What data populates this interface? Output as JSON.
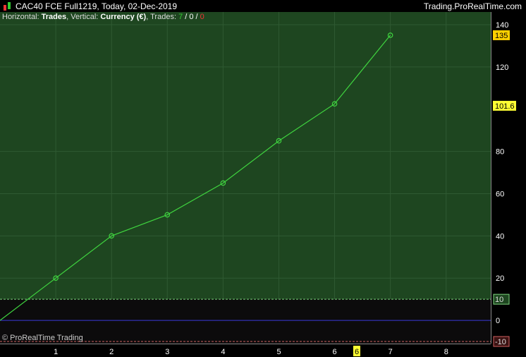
{
  "header": {
    "title": "CAC40 FCE Full1219, Today, 02-Dec-2019",
    "brand": "Trading.ProRealTime.com"
  },
  "info": {
    "h_label": "Horizontal: ",
    "h_value": "Trades",
    "v_label": ", Vertical: ",
    "v_value": "Currency (€)",
    "t_label": ", Trades: ",
    "t_win": "7",
    "sep1": " / ",
    "t_neutral": "0",
    "sep2": " / ",
    "t_loss": "0"
  },
  "copyright": "© ProRealTime Trading",
  "colors": {
    "profit_bg": "#1e4620",
    "neutral_bg": "#0c0b0c",
    "line": "#3fd43f",
    "grid": "#2f5a32",
    "zero_line": "#3a3ad8",
    "upper_band": "#7ed37e",
    "lower_band": "#d06060",
    "marker_fill": "#ffd000",
    "upper_tag_bg": "#1e4620",
    "lower_tag_bg": "#3a1212"
  },
  "chart_data": {
    "type": "line",
    "title": "",
    "xlabel": "Trades",
    "ylabel": "Currency (€)",
    "x": [
      0,
      1,
      2,
      3,
      4,
      5,
      6,
      7
    ],
    "y": [
      0,
      20,
      40,
      50,
      65,
      85,
      102.5,
      135
    ],
    "xlim": [
      0,
      8.8
    ],
    "ylim": [
      -11,
      146
    ],
    "x_ticks": [
      "1",
      "2",
      "3",
      "4",
      "5",
      "6",
      "7",
      "8"
    ],
    "y_ticks": [
      "140",
      "120",
      "80",
      "60",
      "40",
      "20",
      "0"
    ],
    "y_band_labels": {
      "upper": "10",
      "lower": "-10"
    },
    "markers": {
      "last_value": "135",
      "mid_value": "101.6",
      "x_cursor": "6"
    },
    "grid": true
  }
}
